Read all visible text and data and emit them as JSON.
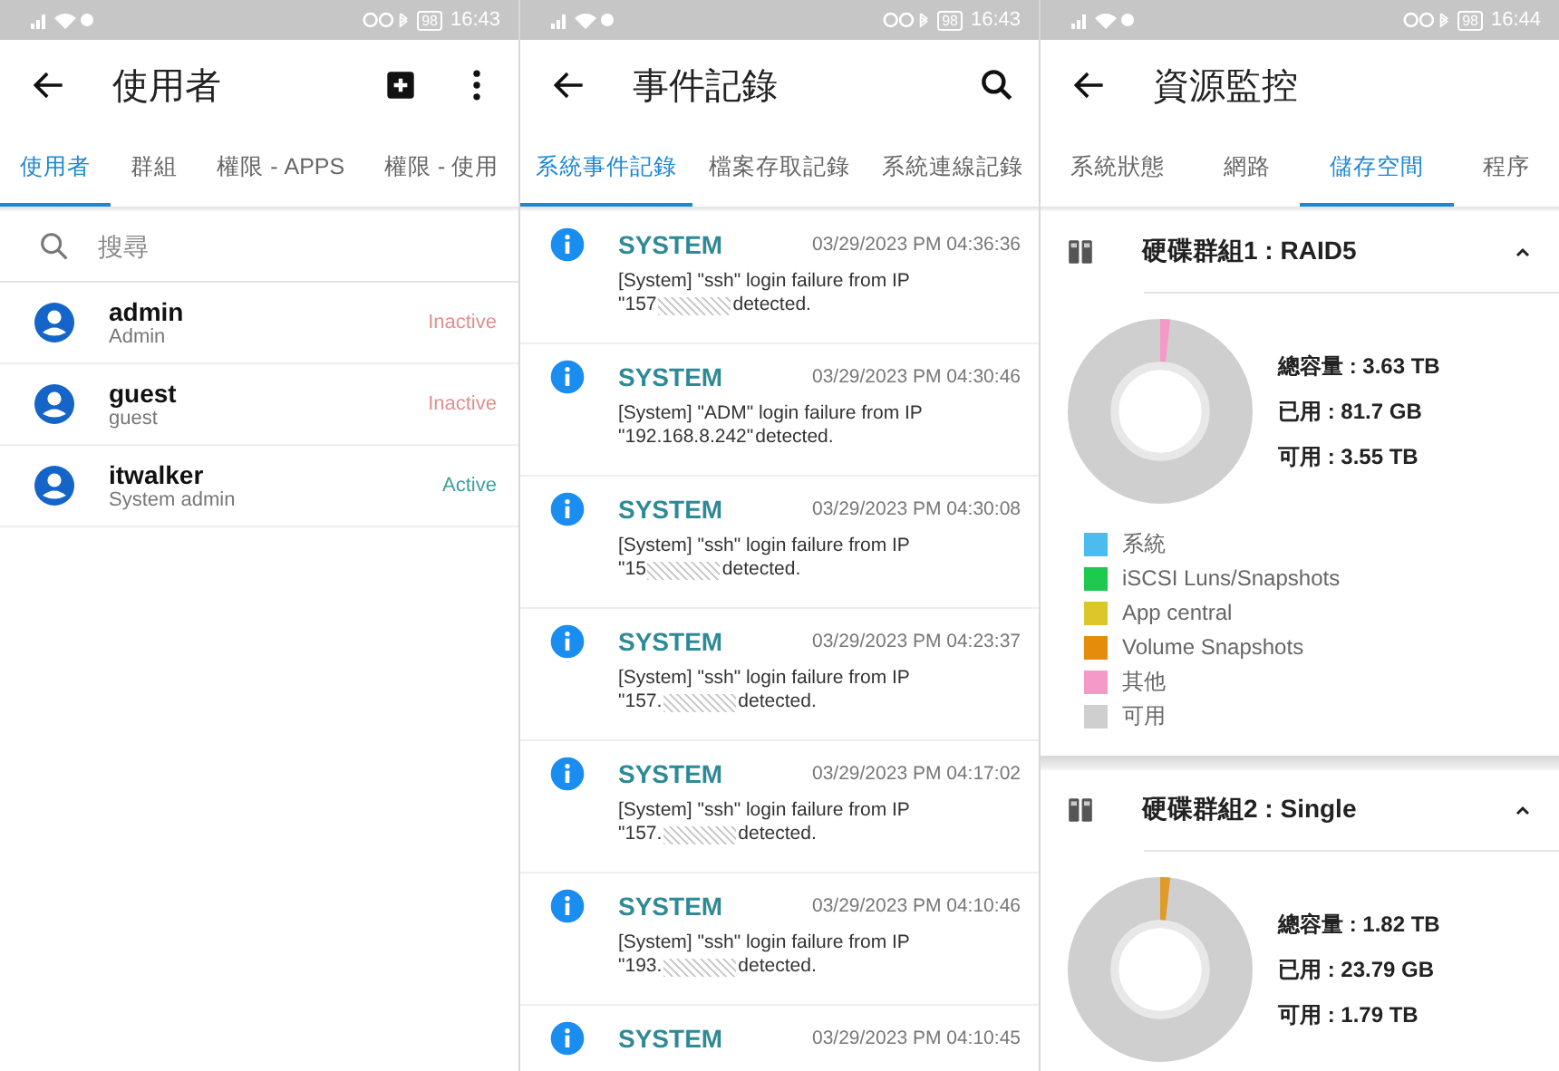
{
  "screens": [
    {
      "kind": "users",
      "status_bar": {
        "battery": "98",
        "time": "16:43"
      },
      "title": "使用者",
      "tabs": [
        {
          "label": "使用者",
          "selected": true
        },
        {
          "label": "群組",
          "selected": false
        },
        {
          "label": "權限 - APPS",
          "selected": false
        },
        {
          "label": "權限 - 使用",
          "selected": false
        }
      ],
      "search": {
        "placeholder": "搜尋"
      },
      "users": [
        {
          "name": "admin",
          "role": "Admin",
          "status": "Inactive",
          "active": false
        },
        {
          "name": "guest",
          "role": "guest",
          "status": "Inactive",
          "active": false
        },
        {
          "name": "itwalker",
          "role": "System admin",
          "status": "Active",
          "active": true
        }
      ]
    },
    {
      "kind": "events",
      "status_bar": {
        "battery": "98",
        "time": "16:43"
      },
      "title": "事件記錄",
      "tabs": [
        {
          "label": "系統事件記錄",
          "selected": true
        },
        {
          "label": "檔案存取記錄",
          "selected": false
        },
        {
          "label": "系統連線記錄",
          "selected": false
        }
      ],
      "events": [
        {
          "source": "SYSTEM",
          "time": "03/29/2023 PM 04:36:36",
          "line1": "[System] \"ssh\" login failure from IP",
          "ip": "\"157",
          "redacted": true,
          "tail": "detected."
        },
        {
          "source": "SYSTEM",
          "time": "03/29/2023 PM 04:30:46",
          "line1": "[System] \"ADM\" login failure from IP",
          "ip": "\"192.168.8.242\"",
          "redacted": false,
          "tail": "detected."
        },
        {
          "source": "SYSTEM",
          "time": "03/29/2023 PM 04:30:08",
          "line1": "[System] \"ssh\" login failure from IP",
          "ip": "\"15",
          "redacted": true,
          "tail": "detected."
        },
        {
          "source": "SYSTEM",
          "time": "03/29/2023 PM 04:23:37",
          "line1": "[System] \"ssh\" login failure from IP",
          "ip": "\"157.",
          "redacted": true,
          "tail": "detected."
        },
        {
          "source": "SYSTEM",
          "time": "03/29/2023 PM 04:17:02",
          "line1": "[System] \"ssh\" login failure from IP",
          "ip": "\"157.",
          "redacted": true,
          "tail": "detected."
        },
        {
          "source": "SYSTEM",
          "time": "03/29/2023 PM 04:10:46",
          "line1": "[System] \"ssh\" login failure from IP",
          "ip": "\"193.",
          "redacted": true,
          "tail": "detected."
        },
        {
          "source": "SYSTEM",
          "time": "03/29/2023 PM 04:10:45"
        }
      ]
    },
    {
      "kind": "storage",
      "status_bar": {
        "battery": "98",
        "time": "16:44"
      },
      "title": "資源監控",
      "tabs": [
        {
          "label": "系統狀態",
          "selected": false
        },
        {
          "label": "網路",
          "selected": false
        },
        {
          "label": "儲存空間",
          "selected": true
        },
        {
          "label": "程序",
          "selected": false
        }
      ],
      "groups": [
        {
          "title": "硬碟群組1 : RAID5",
          "expanded": true,
          "color": "#f59ac8",
          "stats": [
            "總容量 : 3.63 TB",
            "已用 : 81.7 GB",
            "可用 : 3.55 TB"
          ],
          "legend": [
            {
              "label": "系統",
              "color": "#4cbcf0"
            },
            {
              "label": "iSCSI Luns/Snapshots",
              "color": "#1ec94f"
            },
            {
              "label": "App central",
              "color": "#dcc72a"
            },
            {
              "label": "Volume Snapshots",
              "color": "#e58c0c"
            },
            {
              "label": "其他",
              "color": "#f59ac8"
            },
            {
              "label": "可用",
              "color": "#cfcfcf"
            }
          ]
        },
        {
          "title": "硬碟群組2 : Single",
          "expanded": true,
          "color": "#e09a2a",
          "stats": [
            "總容量 : 1.82 TB",
            "已用 : 23.79 GB",
            "可用 : 1.79 TB"
          ]
        }
      ]
    }
  ]
}
